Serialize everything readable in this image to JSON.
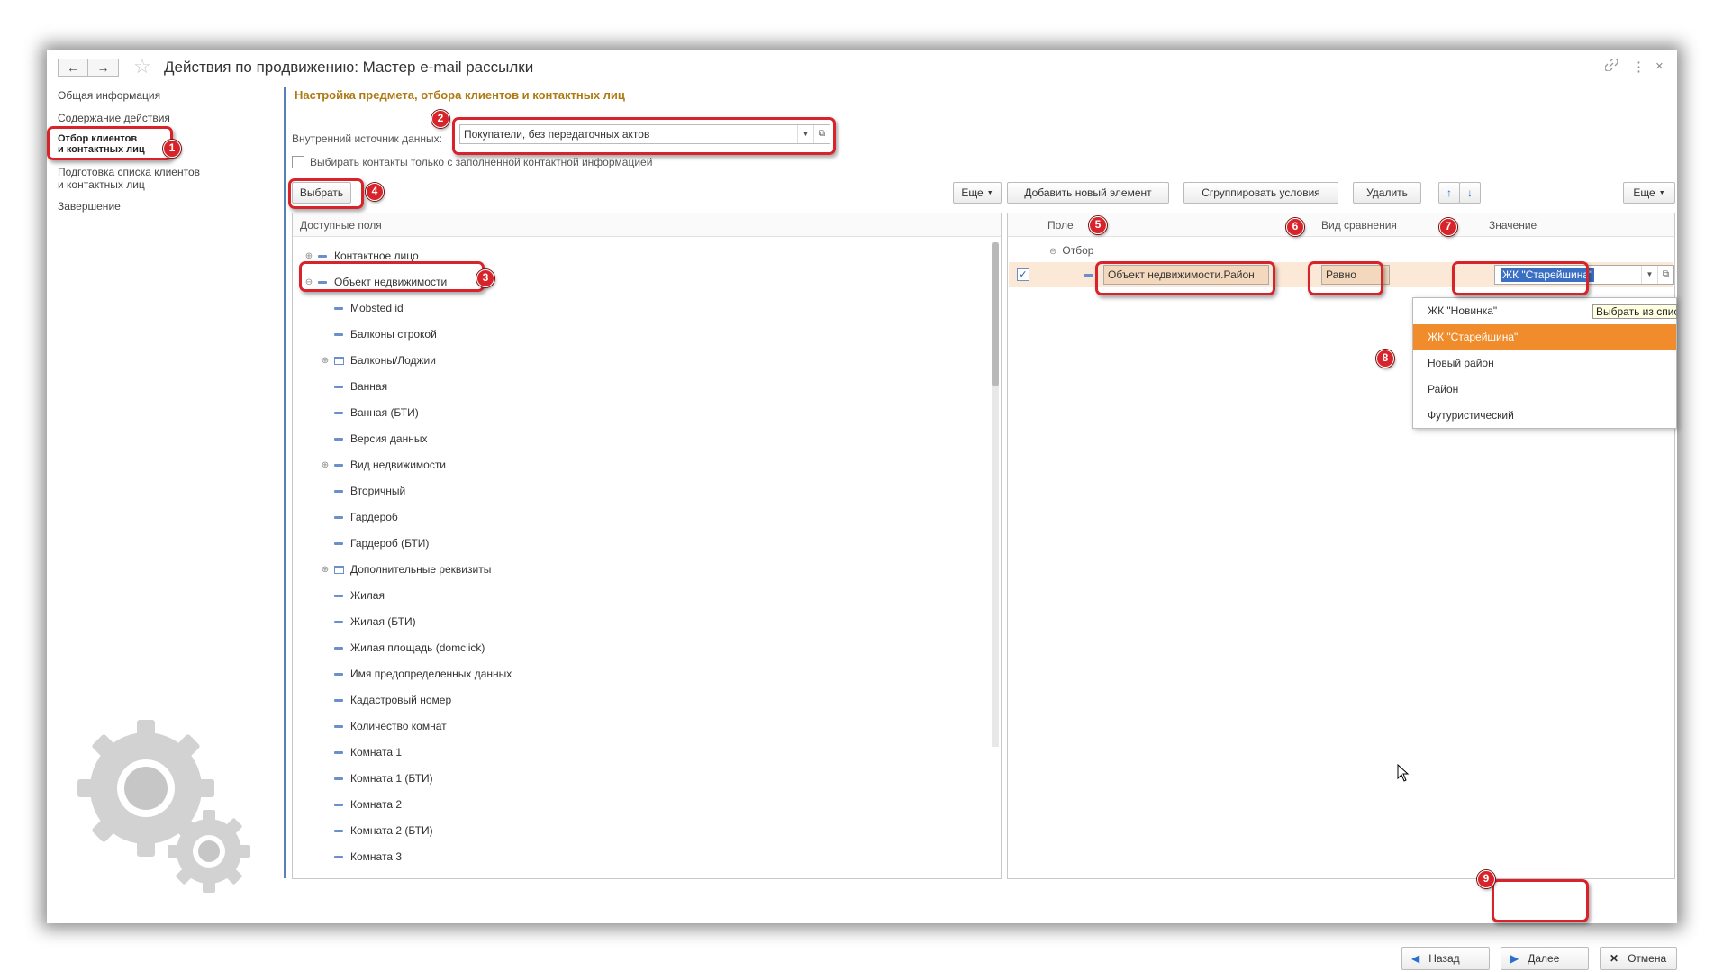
{
  "window": {
    "title": "Действия по продвижению: Мастер e-mail рассылки",
    "back_icon": "←",
    "forward_icon": "→",
    "star_icon": "☆",
    "link_icon": "🔗",
    "menu_icon": "⋮",
    "close_icon": "×"
  },
  "leftnav": {
    "items": [
      {
        "label": "Общая информация"
      },
      {
        "label": "Содержание действия"
      },
      {
        "label": "Отбор клиентов\nи контактных лиц"
      },
      {
        "label": "Подготовка списка клиентов\nи контактных лиц"
      },
      {
        "label": "Завершение"
      }
    ]
  },
  "main": {
    "section_title": "Настройка предмета, отбора клиентов и контактных лиц",
    "source_label": "Внутренний источник данных:",
    "source_value": "Покупатели, без передаточных актов",
    "checkbox_label": "Выбирать контакты только с заполненной контактной информацией",
    "select_button": "Выбрать",
    "more_button": "Еще",
    "add_button": "Добавить новый элемент",
    "group_button": "Сгруппировать условия",
    "delete_button": "Удалить",
    "up_icon": "↑",
    "down_icon": "↓"
  },
  "available_fields": {
    "header": "Доступные поля",
    "rows": [
      {
        "label": "Контактное лицо",
        "expander": "⊕",
        "icon": "dash"
      },
      {
        "label": "Объект недвижимости",
        "expander": "⊖",
        "icon": "dash"
      },
      {
        "label": "Mobsted id",
        "expander": "",
        "icon": "dash"
      },
      {
        "label": "Балконы строкой",
        "expander": "",
        "icon": "dash"
      },
      {
        "label": "Балконы/Лоджии",
        "expander": "⊕",
        "icon": "table"
      },
      {
        "label": "Ванная",
        "expander": "",
        "icon": "dash"
      },
      {
        "label": "Ванная (БТИ)",
        "expander": "",
        "icon": "dash"
      },
      {
        "label": "Версия данных",
        "expander": "",
        "icon": "dash"
      },
      {
        "label": "Вид недвижимости",
        "expander": "⊕",
        "icon": "dash"
      },
      {
        "label": "Вторичный",
        "expander": "",
        "icon": "dash"
      },
      {
        "label": "Гардероб",
        "expander": "",
        "icon": "dash"
      },
      {
        "label": "Гардероб (БТИ)",
        "expander": "",
        "icon": "dash"
      },
      {
        "label": "Дополнительные реквизиты",
        "expander": "⊕",
        "icon": "table"
      },
      {
        "label": "Жилая",
        "expander": "",
        "icon": "dash"
      },
      {
        "label": "Жилая (БТИ)",
        "expander": "",
        "icon": "dash"
      },
      {
        "label": "Жилая площадь (domclick)",
        "expander": "",
        "icon": "dash"
      },
      {
        "label": "Имя предопределенных данных",
        "expander": "",
        "icon": "dash"
      },
      {
        "label": "Кадастровый номер",
        "expander": "",
        "icon": "dash"
      },
      {
        "label": "Количество комнат",
        "expander": "",
        "icon": "dash"
      },
      {
        "label": "Комната 1",
        "expander": "",
        "icon": "dash"
      },
      {
        "label": "Комната 1 (БТИ)",
        "expander": "",
        "icon": "dash"
      },
      {
        "label": "Комната 2",
        "expander": "",
        "icon": "dash"
      },
      {
        "label": "Комната 2 (БТИ)",
        "expander": "",
        "icon": "dash"
      },
      {
        "label": "Комната 3",
        "expander": "",
        "icon": "dash"
      }
    ]
  },
  "filter_panel": {
    "col_field": "Поле",
    "col_compare": "Вид сравнения",
    "col_value": "Значение",
    "group_label": "Отбор",
    "row": {
      "checked": "✓",
      "field": "Объект недвижимости.Район",
      "compare": "Равно",
      "value": "ЖК \"Старейшина\""
    }
  },
  "dropdown": {
    "tooltip": "Выбрать из списка",
    "items": [
      "ЖК \"Новинка\"",
      "ЖК \"Старейшина\"",
      "Новый район",
      "Район",
      "Футуристический"
    ],
    "selected_index": 1
  },
  "footer": {
    "back_button": "Назад",
    "next_button": "Далее",
    "cancel_button": "Отмена"
  },
  "markers": [
    "1",
    "2",
    "3",
    "4",
    "5",
    "6",
    "7",
    "8",
    "9"
  ],
  "colors": {
    "annotation": "#d8232a",
    "selection_orange": "#f08c2c",
    "section_title": "#b07a12",
    "accent_blue": "#3b6fc4"
  }
}
